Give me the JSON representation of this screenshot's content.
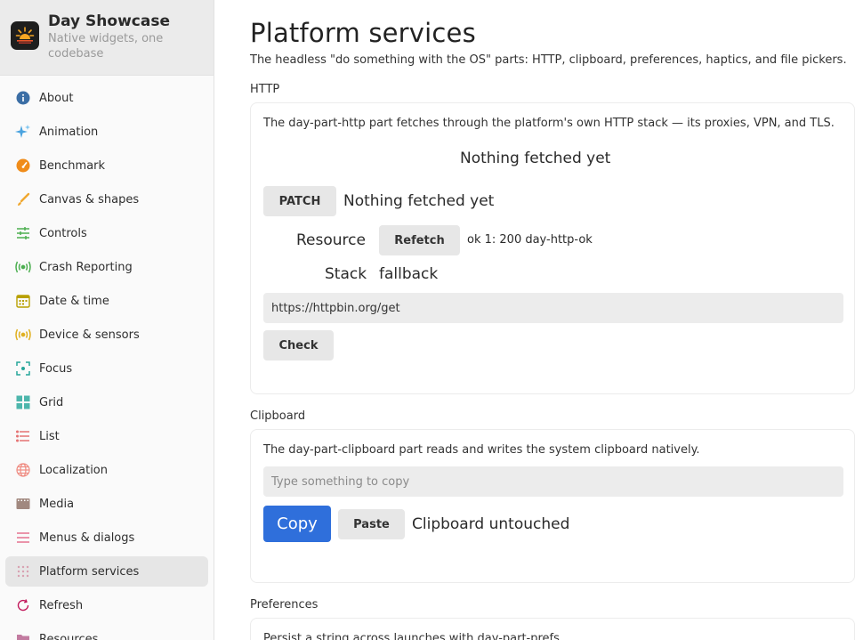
{
  "app": {
    "title": "Day Showcase",
    "subtitle": "Native widgets, one codebase"
  },
  "sidebar": {
    "items": [
      {
        "label": "About",
        "icon": "info-icon",
        "color": "#3b6ea5"
      },
      {
        "label": "Animation",
        "icon": "sparkle-icon",
        "color": "#4aa3df"
      },
      {
        "label": "Benchmark",
        "icon": "speedometer-icon",
        "color": "#f08c1a"
      },
      {
        "label": "Canvas & shapes",
        "icon": "brush-icon",
        "color": "#f0a830"
      },
      {
        "label": "Controls",
        "icon": "sliders-icon",
        "color": "#4caf50"
      },
      {
        "label": "Crash Reporting",
        "icon": "broadcast-icon",
        "color": "#4caf50"
      },
      {
        "label": "Date & time",
        "icon": "calendar-icon",
        "color": "#b8a000"
      },
      {
        "label": "Device & sensors",
        "icon": "sensor-icon",
        "color": "#e0b020"
      },
      {
        "label": "Focus",
        "icon": "focus-icon",
        "color": "#26a69a"
      },
      {
        "label": "Grid",
        "icon": "grid-icon",
        "color": "#4db6ac"
      },
      {
        "label": "List",
        "icon": "list-icon",
        "color": "#e57373"
      },
      {
        "label": "Localization",
        "icon": "globe-icon",
        "color": "#ef8a80"
      },
      {
        "label": "Media",
        "icon": "film-icon",
        "color": "#a1887f"
      },
      {
        "label": "Menus & dialogs",
        "icon": "menu-icon",
        "color": "#e57390"
      },
      {
        "label": "Platform services",
        "icon": "dots-grid-icon",
        "color": "#d8a0b0",
        "active": true
      },
      {
        "label": "Refresh",
        "icon": "refresh-icon",
        "color": "#c2185b"
      },
      {
        "label": "Resources",
        "icon": "folder-icon",
        "color": "#c27ba0"
      }
    ]
  },
  "page": {
    "title": "Platform services",
    "description": "The headless \"do something with the OS\" parts: HTTP, clipboard, preferences, haptics, and file pickers."
  },
  "http": {
    "section_label": "HTTP",
    "description": "The day-part-http part fetches through the platform's own HTTP stack — its proxies, VPN, and TLS.",
    "status_center": "Nothing fetched yet",
    "patch_label": "PATCH",
    "patch_status": "Nothing fetched yet",
    "resource_label": "Resource",
    "refetch_label": "Refetch",
    "refetch_status": "ok 1: 200 day-http-ok",
    "stack_label": "Stack",
    "stack_value": "fallback",
    "url_value": "https://httpbin.org/get",
    "check_label": "Check"
  },
  "clipboard": {
    "section_label": "Clipboard",
    "description": "The day-part-clipboard part reads and writes the system clipboard natively.",
    "input_placeholder": "Type something to copy",
    "copy_label": "Copy",
    "paste_label": "Paste",
    "status": "Clipboard untouched"
  },
  "preferences": {
    "section_label": "Preferences",
    "description": "Persist a string across launches with day-part-prefs."
  }
}
